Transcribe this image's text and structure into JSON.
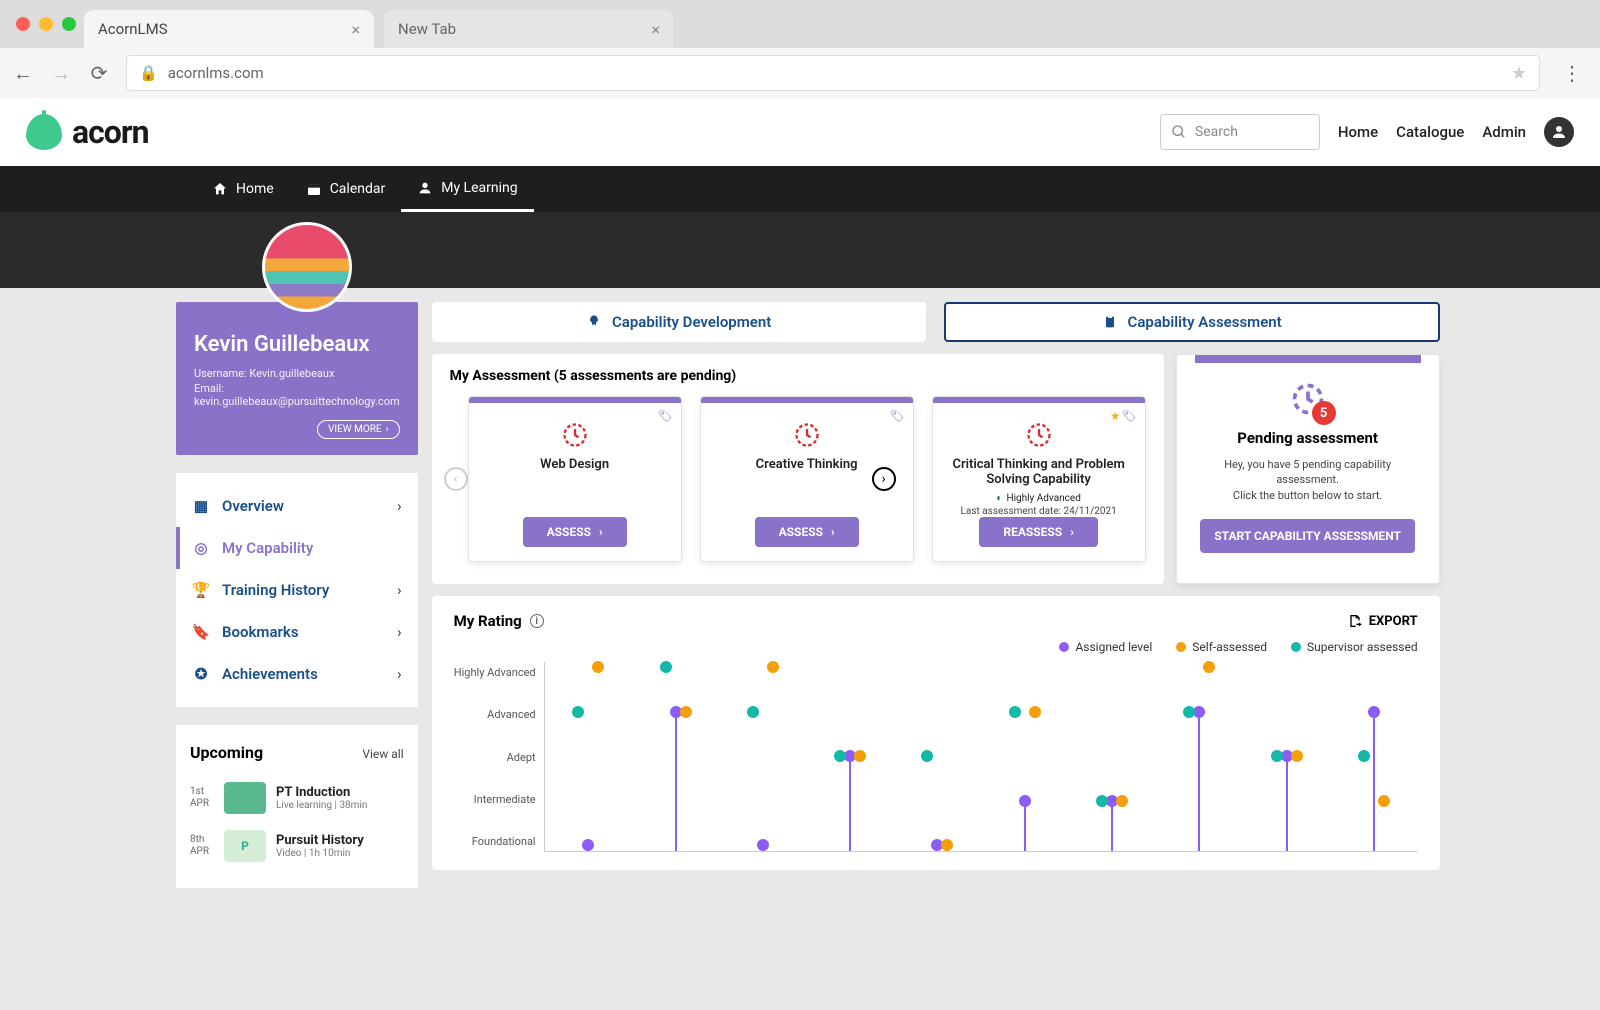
{
  "browser": {
    "tabs": [
      {
        "title": "AcornLMS",
        "active": true
      },
      {
        "title": "New Tab",
        "active": false
      }
    ],
    "url": "acornlms.com"
  },
  "header": {
    "logo_text": "acorn",
    "search_placeholder": "Search",
    "links": [
      "Home",
      "Catalogue",
      "Admin"
    ]
  },
  "navbar": {
    "items": [
      {
        "label": "Home",
        "icon": "home-icon"
      },
      {
        "label": "Calendar",
        "icon": "calendar-icon"
      },
      {
        "label": "My Learning",
        "icon": "person-icon",
        "active": true
      }
    ]
  },
  "user": {
    "name": "Kevin Guillebeaux",
    "username_label": "Username:",
    "username": "Kevin.guillebeaux",
    "email_label": "Email:",
    "email": "kevin.guillebeaux@pursuittechnology.com",
    "view_more": "VIEW MORE"
  },
  "side_nav": [
    {
      "label": "Overview",
      "icon": "grid-icon"
    },
    {
      "label": "My Capability",
      "icon": "target-icon",
      "active": true
    },
    {
      "label": "Training History",
      "icon": "trophy-icon"
    },
    {
      "label": "Bookmarks",
      "icon": "bookmark-icon"
    },
    {
      "label": "Achievements",
      "icon": "star-badge-icon"
    }
  ],
  "upcoming": {
    "title": "Upcoming",
    "view_all": "View all",
    "items": [
      {
        "date_top": "1st",
        "date_bottom": "APR",
        "title": "PT Induction",
        "subtitle": "Live learning   |   38min"
      },
      {
        "date_top": "8th",
        "date_bottom": "APR",
        "title": "Pursuit History",
        "subtitle": "Video   |   1h 10min"
      }
    ]
  },
  "toggles": {
    "development": "Capability Development",
    "assessment": "Capability Assessment"
  },
  "assessments": {
    "heading": "My Assessment (5 assessments are pending)",
    "cards": [
      {
        "title": "Web Design",
        "button": "ASSESS"
      },
      {
        "title": "Creative Thinking",
        "button": "ASSESS"
      },
      {
        "title": "Critical Thinking and Problem Solving Capability",
        "level": "Highly Advanced",
        "last": "Last assessment date: 24/11/2021",
        "button": "REASSESS",
        "starred": true
      }
    ],
    "pending": {
      "count": "5",
      "title": "Pending assessment",
      "text1": "Hey, you have 5 pending capability assessment.",
      "text2": "Click the button below to start.",
      "button": "START CAPABILITY ASSESSMENT"
    }
  },
  "rating": {
    "title": "My Rating",
    "export": "EXPORT",
    "legend": [
      "Assigned level",
      "Self-assessed",
      "Supervisor assessed"
    ],
    "y_ticks": [
      "Highly Advanced",
      "Advanced",
      "Adept",
      "Intermediate",
      "Foundational"
    ]
  },
  "chart_data": {
    "type": "scatter",
    "y_categories": [
      "Foundational",
      "Intermediate",
      "Adept",
      "Advanced",
      "Highly Advanced"
    ],
    "x_count": 10,
    "series": [
      {
        "name": "Assigned level",
        "color": "#8b5cf6",
        "values": [
          1,
          4,
          1,
          3,
          1,
          2,
          2,
          4,
          3,
          4
        ]
      },
      {
        "name": "Self-assessed",
        "color": "#f59e0b",
        "values": [
          5,
          4,
          5,
          3,
          1,
          4,
          2,
          5,
          3,
          2
        ]
      },
      {
        "name": "Supervisor assessed",
        "color": "#14b8a6",
        "values": [
          4,
          5,
          4,
          3,
          3,
          4,
          2,
          4,
          3,
          3
        ]
      }
    ]
  }
}
